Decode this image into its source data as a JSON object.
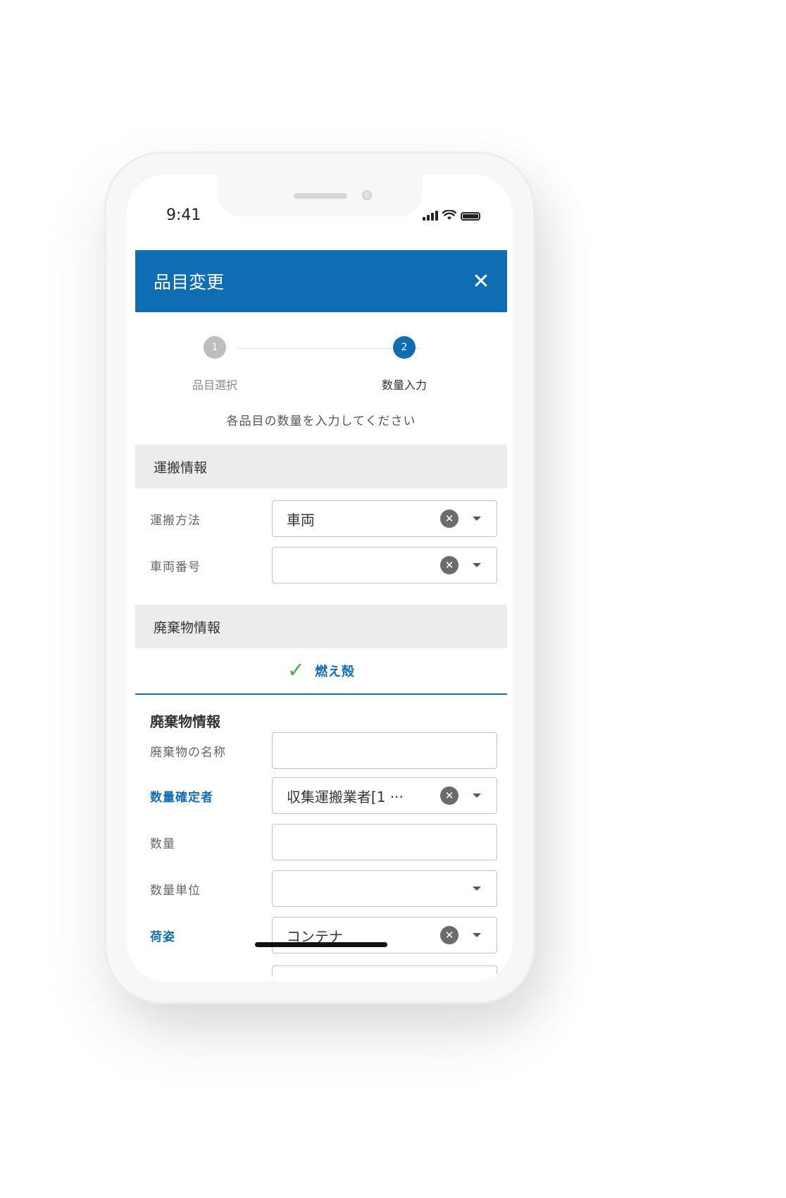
{
  "status_bar": {
    "time": "9:41"
  },
  "header": {
    "title": "品目変更",
    "close_icon": "close-icon",
    "color": "#0f6db3"
  },
  "stepper": {
    "steps": [
      {
        "number": "1",
        "label": "品目選択",
        "active": false
      },
      {
        "number": "2",
        "label": "数量入力",
        "active": true
      }
    ]
  },
  "instruction": "各品目の数量を入力してください",
  "transport": {
    "section_title": "運搬情報",
    "fields": [
      {
        "label": "運搬方法",
        "value": "車両"
      },
      {
        "label": "車両番号",
        "value": ""
      }
    ]
  },
  "waste": {
    "section_title": "廃棄物情報",
    "tab_label": "燃え殻",
    "sub_title": "廃棄物情報",
    "fields": [
      {
        "label": "廃棄物の名称",
        "value": ""
      },
      {
        "label": "数量確定者",
        "value": "収集運搬業者[1 ···"
      },
      {
        "label": "数量",
        "value": ""
      },
      {
        "label": "数量単位",
        "value": ""
      },
      {
        "label": "荷姿",
        "value": "コンテナ"
      }
    ]
  }
}
